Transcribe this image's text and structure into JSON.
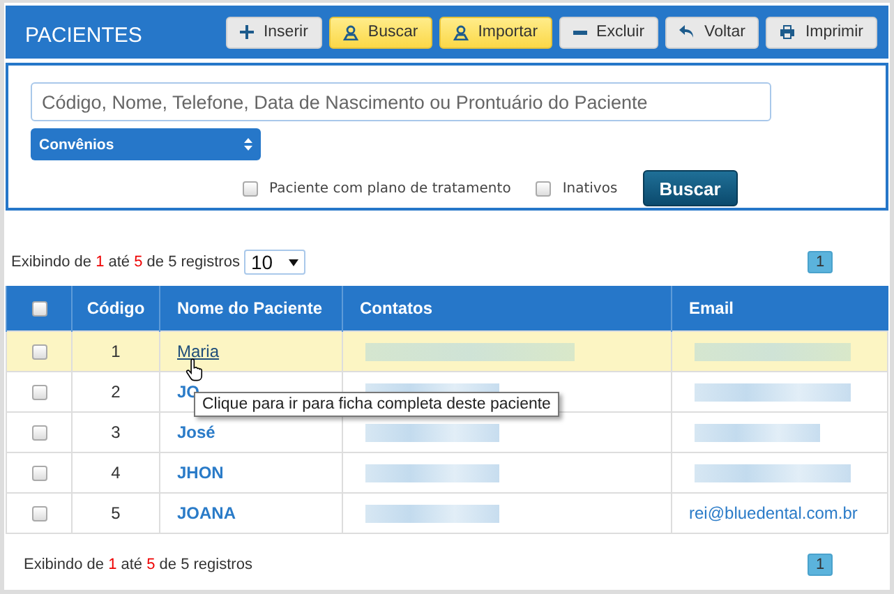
{
  "header": {
    "title": "PACIENTES",
    "buttons": [
      {
        "label": "Inserir",
        "kind": "default"
      },
      {
        "label": "Buscar",
        "kind": "warning"
      },
      {
        "label": "Importar",
        "kind": "warning"
      },
      {
        "label": "Excluir",
        "kind": "default"
      },
      {
        "label": "Voltar",
        "kind": "default"
      },
      {
        "label": "Imprimir",
        "kind": "default"
      }
    ]
  },
  "search": {
    "placeholder": "Código, Nome, Telefone, Data de Nascimento ou Prontuário do Paciente",
    "insurance_select": "Convênios",
    "filters": [
      {
        "label": "Paciente com plano de tratamento",
        "checked": false
      },
      {
        "label": "Inativos",
        "checked": false
      }
    ],
    "button": "Buscar"
  },
  "top_info": {
    "prefix": "Exibindo de",
    "from": "1",
    "middle": "até",
    "to": "5",
    "suffix": "de 5 registros"
  },
  "page_size": "10",
  "pages_top": [
    {
      "label": "1",
      "selected": true
    }
  ],
  "table": {
    "all_checked": false,
    "columns": [
      "Código",
      "Nome do Paciente",
      "Contatos",
      "Email"
    ],
    "rows": [
      {
        "checked": false,
        "code": "1",
        "name": "Maria",
        "highlighted": true,
        "contact_redacted": true,
        "email_redacted": true
      },
      {
        "checked": false,
        "code": "2",
        "name": "JO",
        "highlighted": false,
        "contact_redacted": true,
        "email_redacted": true
      },
      {
        "checked": false,
        "code": "3",
        "name": "José",
        "highlighted": false,
        "contact_redacted": true,
        "email_redacted": true
      },
      {
        "checked": false,
        "code": "4",
        "name": "JHON",
        "highlighted": false,
        "contact_redacted": true,
        "email_redacted": true
      },
      {
        "checked": false,
        "code": "5",
        "name": "JOANA",
        "highlighted": false,
        "contact_redacted": true,
        "email_redacted": false,
        "email": "rei@bluedental.com.br"
      }
    ]
  },
  "tooltip": "Clique para ir para ficha completa deste paciente",
  "bottom_info": {
    "prefix": "Exibindo de",
    "from": "1",
    "middle": "até",
    "to": "5",
    "suffix": "de 5 registros"
  },
  "pages_bottom": [
    {
      "label": "1",
      "selected": true
    }
  ]
}
